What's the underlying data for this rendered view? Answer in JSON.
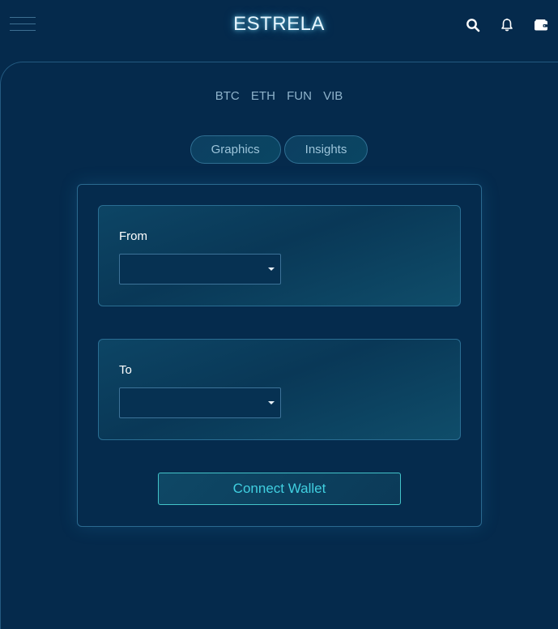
{
  "header": {
    "brand": "ESTRELA",
    "icons": [
      "hamburger-menu-icon",
      "search-icon",
      "bell-icon",
      "wallet-icon"
    ]
  },
  "tickers": [
    "BTC",
    "ETH",
    "FUN",
    "VIB"
  ],
  "tabs": [
    {
      "label": "Graphics"
    },
    {
      "label": "Insights"
    }
  ],
  "swap": {
    "from_label": "From",
    "from_value": "",
    "to_label": "To",
    "to_value": "",
    "connect_label": "Connect Wallet"
  },
  "colors": {
    "background": "#052a4c",
    "accent": "#40cfe0",
    "border": "#2b6a90"
  }
}
